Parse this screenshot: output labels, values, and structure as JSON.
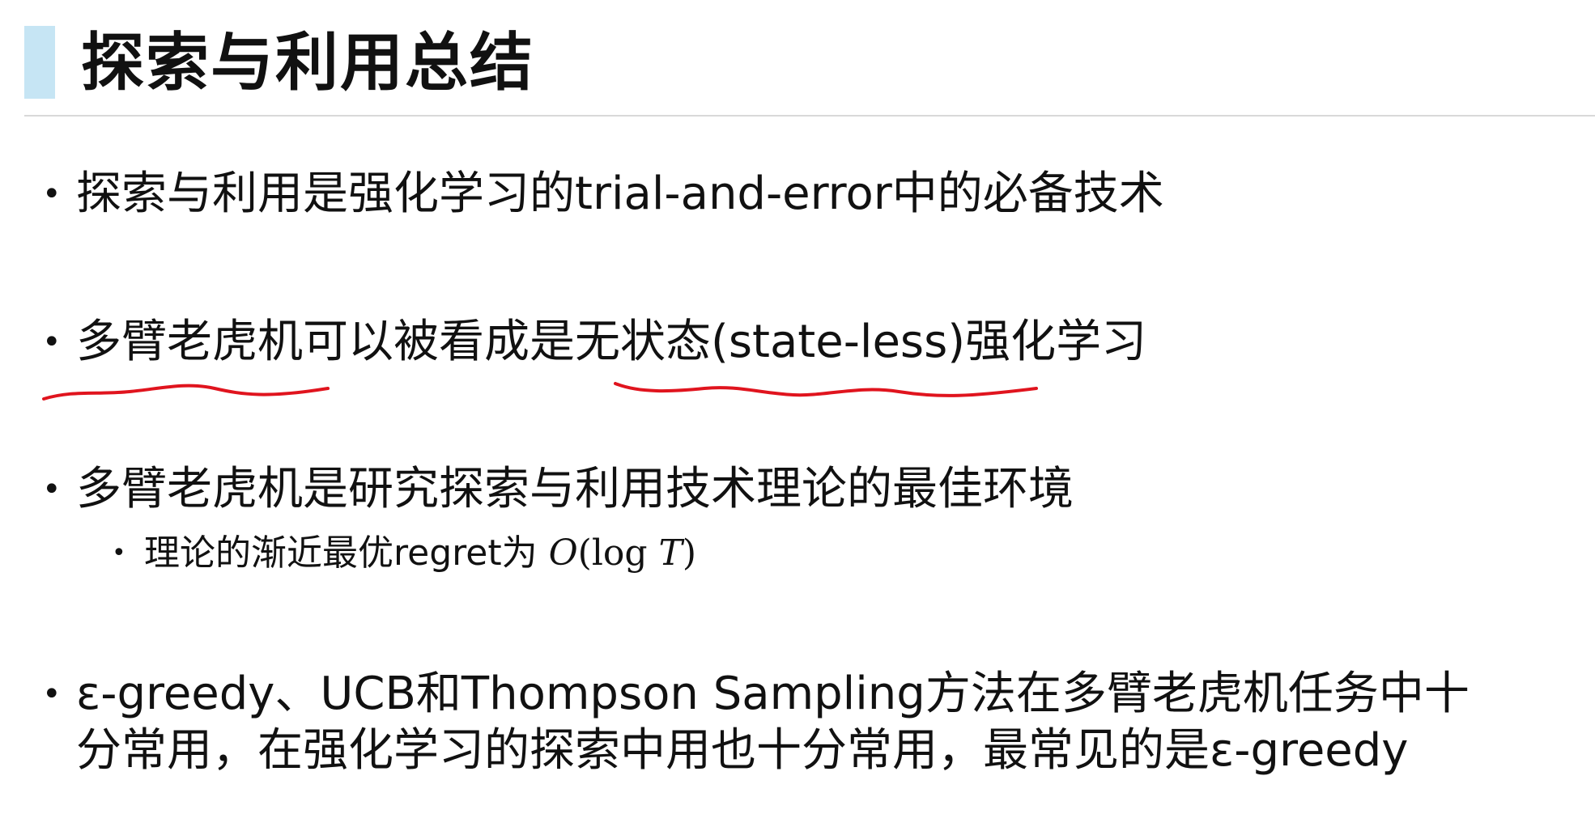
{
  "slide": {
    "title": "探索与利用总结",
    "accent_color": "#c6e5f4",
    "annotation_color": "#e0141e"
  },
  "bullets": [
    {
      "text": "探索与利用是强化学习的trial-and-error中的必备技术"
    },
    {
      "parts": [
        "多臂老虎机",
        "可以被看成是",
        "无状态(state-less)",
        "强化学习"
      ]
    },
    {
      "text": "多臂老虎机是研究探索与利用技术理论的最佳环境",
      "sub": {
        "text": "理论的渐近最优regret为",
        "math": {
          "O": "O",
          "open": "(log ",
          "T": "T",
          "close": ")"
        }
      }
    },
    {
      "lines": [
        "ε-greedy、UCB和Thompson Sampling方法在多臂老虎机任务中十",
        "分常用，在强化学习的探索中用也十分常用，最常见的是ε-greedy"
      ]
    }
  ],
  "bullet_symbol": "•"
}
